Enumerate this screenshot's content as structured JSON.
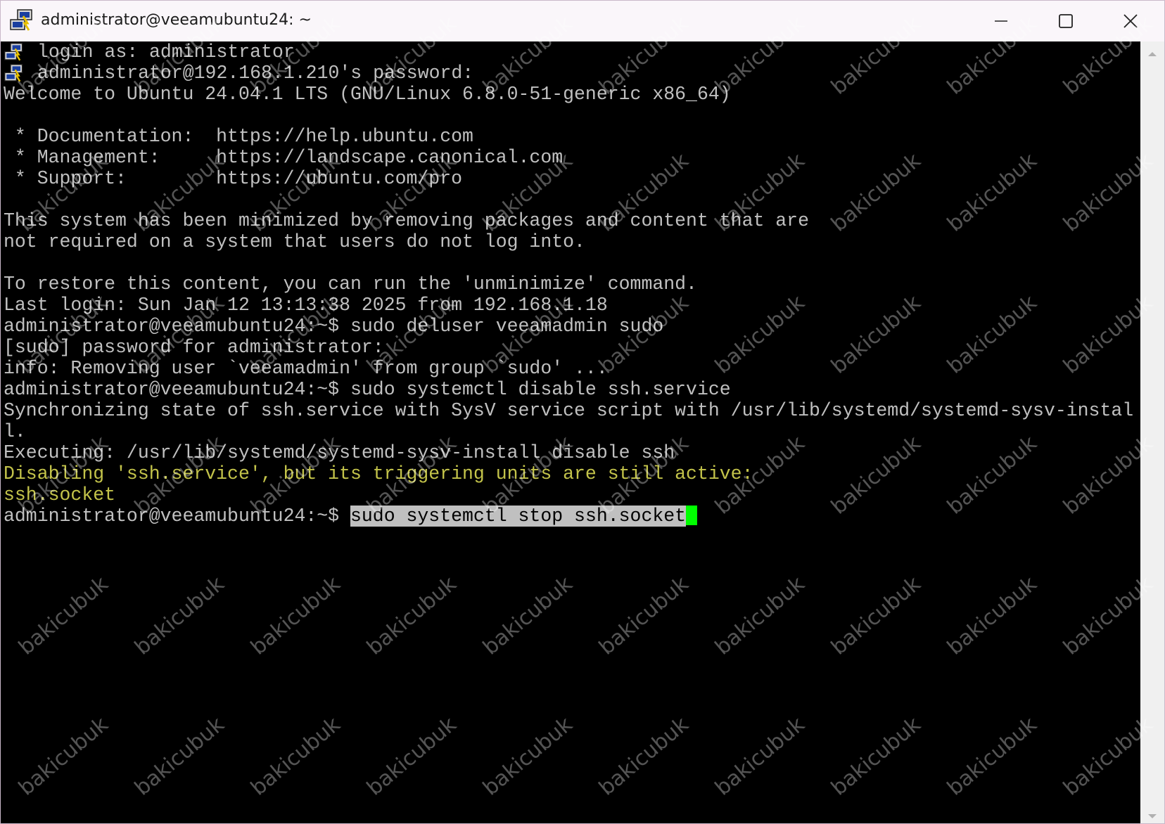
{
  "window": {
    "title": "administrator@veeamubuntu24: ~",
    "app_icon": "putty-icon",
    "controls": [
      "minimize-icon",
      "maximize-icon",
      "close-icon"
    ]
  },
  "terminal": {
    "colors": {
      "background": "#000000",
      "foreground": "#c0c0c0",
      "warning": "#c3c34a",
      "cursor": "#00ff00",
      "selection": "#c0c0c0"
    },
    "lines": [
      {
        "icon": "putty-icon",
        "text": "login as: administrator"
      },
      {
        "icon": "putty-icon",
        "text": "administrator@192.168.1.210's password:"
      },
      {
        "text": "Welcome to Ubuntu 24.04.1 LTS (GNU/Linux 6.8.0-51-generic x86_64)"
      },
      {
        "text": ""
      },
      {
        "text": " * Documentation:  https://help.ubuntu.com"
      },
      {
        "text": " * Management:     https://landscape.canonical.com"
      },
      {
        "text": " * Support:        https://ubuntu.com/pro"
      },
      {
        "text": ""
      },
      {
        "text": "This system has been minimized by removing packages and content that are"
      },
      {
        "text": "not required on a system that users do not log into."
      },
      {
        "text": ""
      },
      {
        "text": "To restore this content, you can run the 'unminimize' command."
      },
      {
        "text": "Last login: Sun Jan 12 13:13:38 2025 from 192.168.1.18"
      },
      {
        "text": "administrator@veeamubuntu24:~$ sudo deluser veeamadmin sudo"
      },
      {
        "text": "[sudo] password for administrator:"
      },
      {
        "text": "info: Removing user `veeamadmin' from group `sudo' ..."
      },
      {
        "text": "administrator@veeamubuntu24:~$ sudo systemctl disable ssh.service"
      },
      {
        "text": "Synchronizing state of ssh.service with SysV service script with /usr/lib/systemd/systemd-sysv-instal"
      },
      {
        "text": "l."
      },
      {
        "text": "Executing: /usr/lib/systemd/systemd-sysv-install disable ssh"
      },
      {
        "style": "warning",
        "text": "Disabling 'ssh.service', but its triggering units are still active:"
      },
      {
        "style": "warning",
        "text": "ssh.socket"
      }
    ],
    "prompt": {
      "text": "administrator@veeamubuntu24:~$ ",
      "selected_command": "sudo systemctl stop ssh.socket"
    }
  },
  "watermark": "bakicubuk"
}
